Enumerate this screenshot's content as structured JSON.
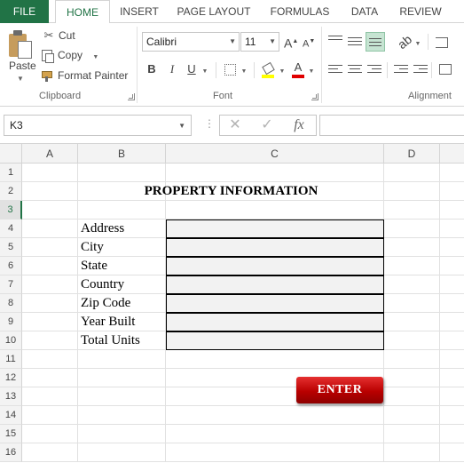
{
  "ribbon": {
    "tabs": [
      "FILE",
      "HOME",
      "INSERT",
      "PAGE LAYOUT",
      "FORMULAS",
      "DATA",
      "REVIEW"
    ],
    "clipboard": {
      "paste": "Paste",
      "cut": "Cut",
      "copy": "Copy",
      "format_painter": "Format Painter",
      "label": "Clipboard"
    },
    "font": {
      "name": "Calibri",
      "size": "11",
      "label": "Font",
      "grow": "A",
      "shrink": "A",
      "bold": "B",
      "italic": "I",
      "underline": "U",
      "font_color": "A",
      "font_color_hex": "#e00000",
      "fill_color_hex": "#ffff00"
    },
    "alignment": {
      "label": "Alignment"
    }
  },
  "formula_bar": {
    "name_box": "K3",
    "fx": "fx",
    "content": ""
  },
  "grid": {
    "columns": [
      "A",
      "B",
      "C",
      "D"
    ],
    "rows": [
      "1",
      "2",
      "3",
      "4",
      "5",
      "6",
      "7",
      "8",
      "9",
      "10",
      "11",
      "12",
      "13",
      "14",
      "15",
      "16"
    ],
    "active_row": "3",
    "title": "PROPERTY INFORMATION",
    "fields": [
      "Address",
      "City",
      "State",
      "Country",
      "Zip Code",
      "Year Built",
      "Total Units"
    ],
    "values": [
      "",
      "",
      "",
      "",
      "",
      "",
      ""
    ]
  },
  "enter_button": {
    "label": "ENTER",
    "color": "#c00000"
  },
  "colors": {
    "accent": "#217346",
    "input_fill": "#f2f2f2"
  }
}
